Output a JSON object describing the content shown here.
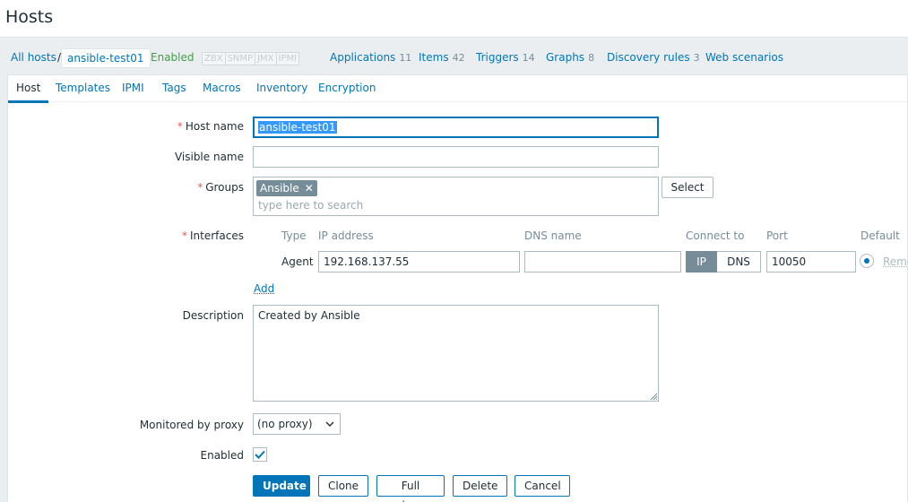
{
  "page": {
    "title": "Hosts"
  },
  "navbar": {
    "all_hosts": "All hosts",
    "separator": "/",
    "current_host": "ansible-test01",
    "status": "Enabled",
    "availability": [
      "ZBX",
      "SNMP",
      "JMX",
      "IPMI"
    ],
    "links": [
      {
        "label": "Applications",
        "count": "11"
      },
      {
        "label": "Items",
        "count": "42"
      },
      {
        "label": "Triggers",
        "count": "14"
      },
      {
        "label": "Graphs",
        "count": "8"
      },
      {
        "label": "Discovery rules",
        "count": "3"
      },
      {
        "label": "Web scenarios",
        "count": ""
      }
    ]
  },
  "tabs": [
    "Host",
    "Templates",
    "IPMI",
    "Tags",
    "Macros",
    "Inventory",
    "Encryption"
  ],
  "form": {
    "required_mark": "*",
    "host_name": {
      "label": "Host name",
      "value": "ansible-test01"
    },
    "visible_name": {
      "label": "Visible name",
      "value": ""
    },
    "groups": {
      "label": "Groups",
      "chips": [
        "Ansible"
      ],
      "placeholder": "type here to search",
      "select_button": "Select"
    },
    "interfaces": {
      "label": "Interfaces",
      "columns": {
        "type": "Type",
        "ip": "IP address",
        "dns": "DNS name",
        "connect": "Connect to",
        "port": "Port",
        "default": "Default"
      },
      "row": {
        "type": "Agent",
        "ip": "192.168.137.55",
        "dns": "",
        "connect_options": [
          "IP",
          "DNS"
        ],
        "connect_selected": "IP",
        "port": "10050",
        "remove": "Remo"
      },
      "add_link": "Add"
    },
    "description": {
      "label": "Description",
      "value": "Created by Ansible"
    },
    "proxy": {
      "label": "Monitored by proxy",
      "value": "(no proxy)"
    },
    "enabled": {
      "label": "Enabled",
      "checked": true
    }
  },
  "buttons": {
    "update": "Update",
    "clone": "Clone",
    "full_clone": "Full clone",
    "delete": "Delete",
    "cancel": "Cancel"
  },
  "colors": {
    "link": "#0275b8",
    "enabled": "#429e47",
    "required": "#e45959",
    "chip": "#768d99",
    "primary": "#0275b8"
  }
}
